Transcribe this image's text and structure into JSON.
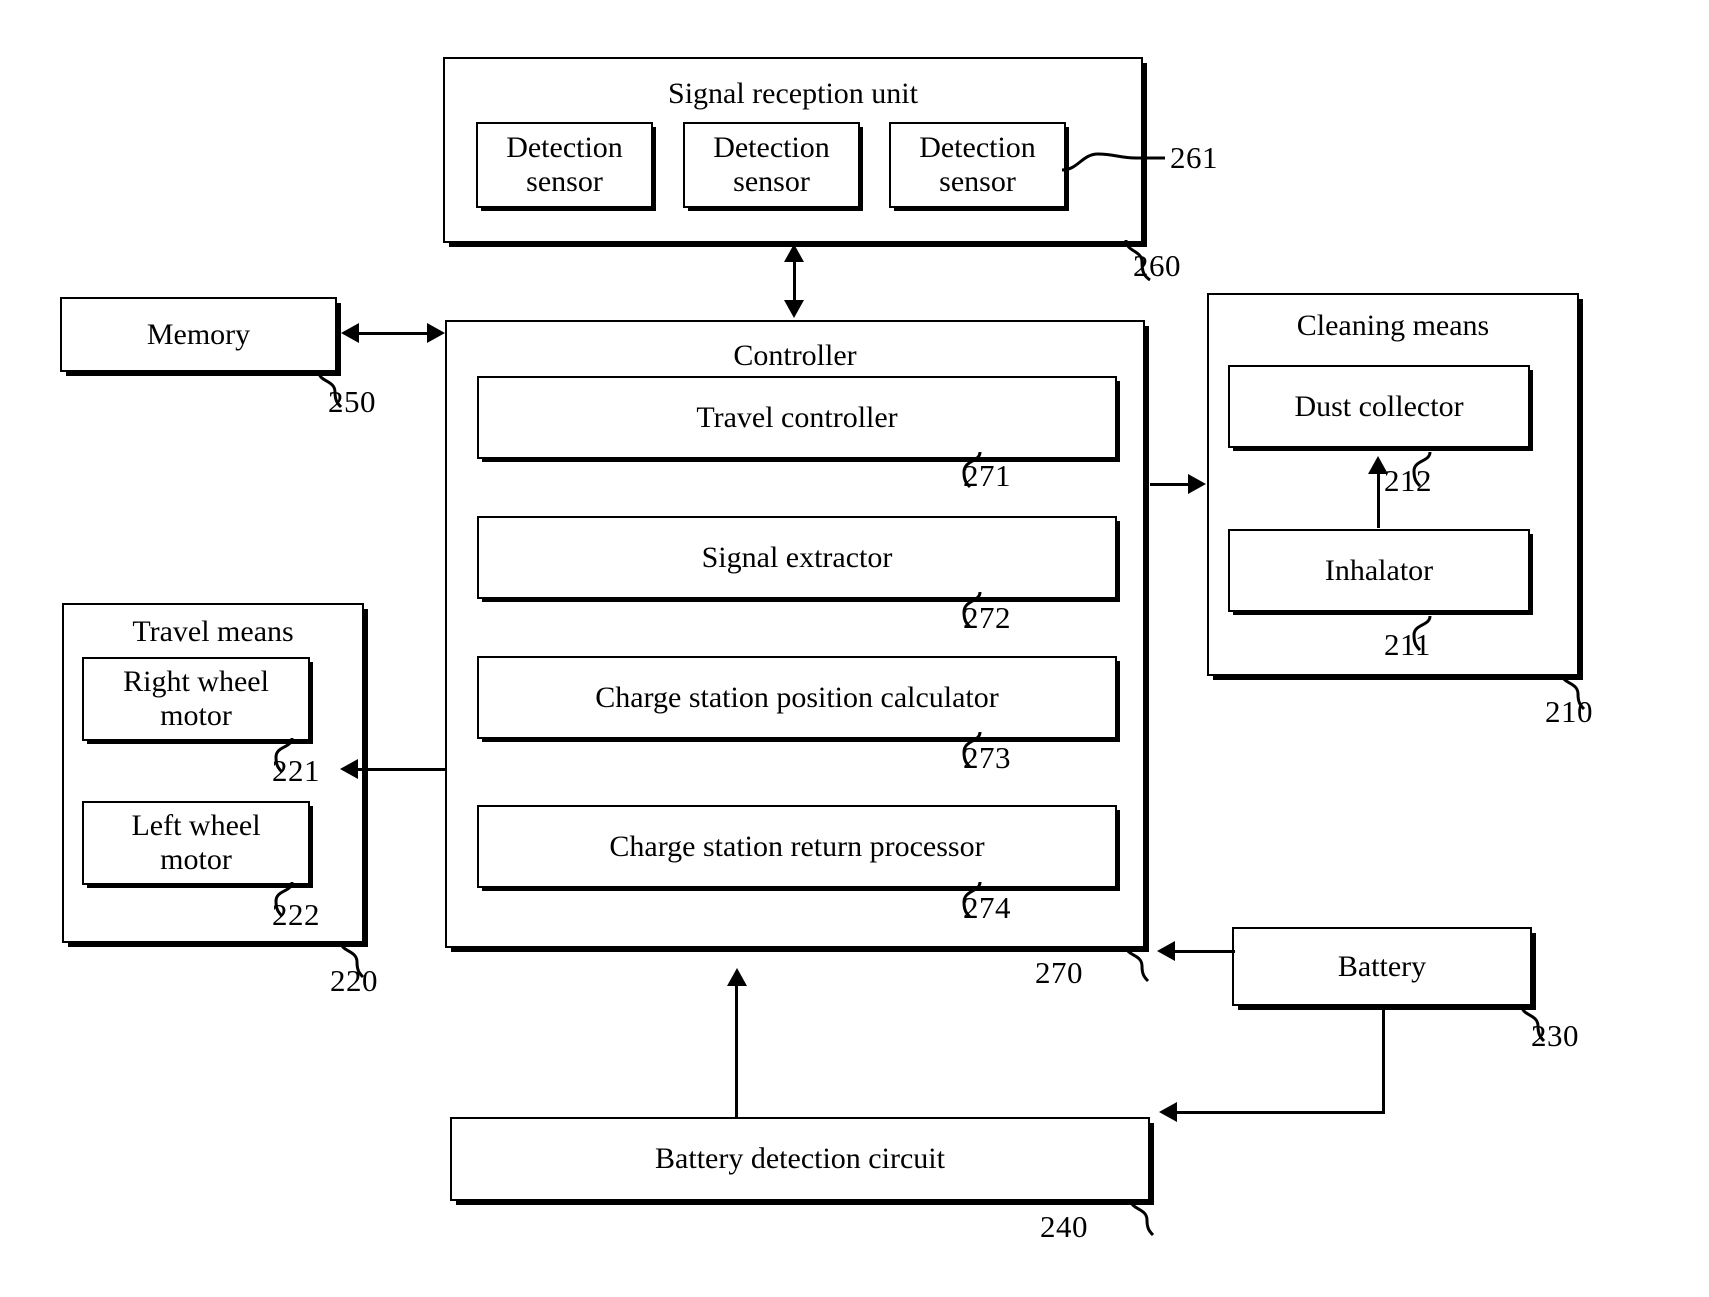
{
  "diagram": {
    "type": "patent-block-diagram",
    "blocks": {
      "signal_reception_unit": {
        "title": "Signal reception unit",
        "ref": "260",
        "sensors_ref": "261",
        "sensors": [
          {
            "label": "Detection\nsensor"
          },
          {
            "label": "Detection\nsensor"
          },
          {
            "label": "Detection\nsensor"
          }
        ],
        "sensor_line1": "Detection",
        "sensor_line2": "sensor"
      },
      "controller": {
        "title": "Controller",
        "ref": "270",
        "modules": [
          {
            "label": "Travel controller",
            "ref": "271"
          },
          {
            "label": "Signal extractor",
            "ref": "272"
          },
          {
            "label": "Charge station position calculator",
            "ref": "273"
          },
          {
            "label": "Charge station return processor",
            "ref": "274"
          }
        ]
      },
      "memory": {
        "title": "Memory",
        "ref": "250"
      },
      "travel_means": {
        "title": "Travel means",
        "ref": "220",
        "motors": [
          {
            "line1": "Right wheel",
            "line2": "motor",
            "ref": "221"
          },
          {
            "line1": "Left wheel",
            "line2": "motor",
            "ref": "222"
          }
        ]
      },
      "cleaning_means": {
        "title": "Cleaning means",
        "ref": "210",
        "parts": [
          {
            "label": "Dust collector",
            "ref": "212"
          },
          {
            "label": "Inhalator",
            "ref": "211"
          }
        ]
      },
      "battery": {
        "title": "Battery",
        "ref": "230"
      },
      "battery_detection_circuit": {
        "title": "Battery detection circuit",
        "ref": "240"
      }
    }
  }
}
